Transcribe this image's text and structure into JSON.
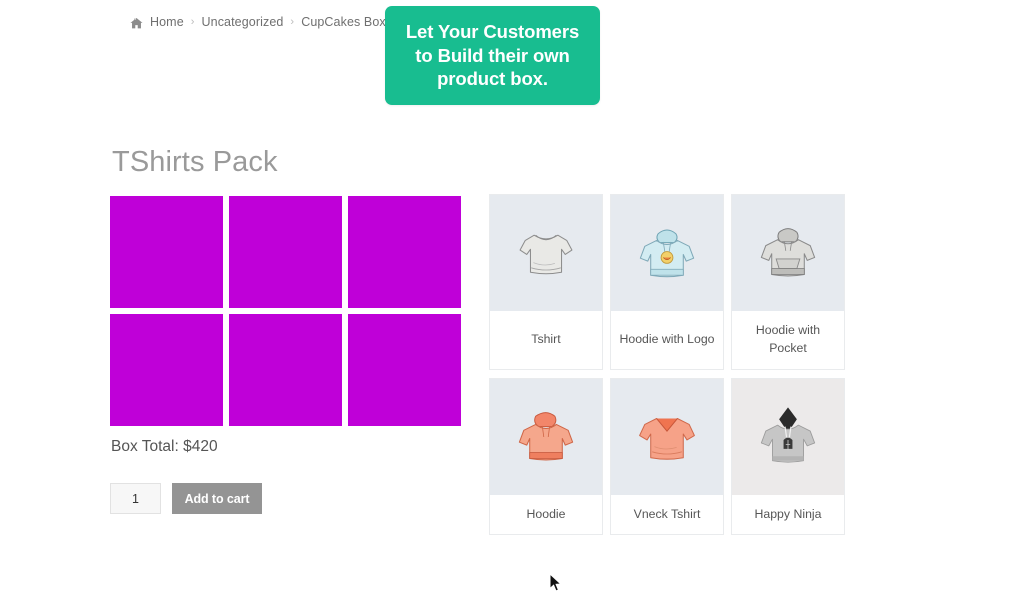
{
  "breadcrumb": {
    "home_icon": "home-icon",
    "items": [
      {
        "label": "Home",
        "current": false
      },
      {
        "label": "Uncategorized",
        "current": false
      },
      {
        "label": "CupCakes Box",
        "current": true
      }
    ],
    "separator": "›"
  },
  "promo": {
    "line1": "Let Your Customers",
    "line2": "to Build their own",
    "line3": "product box.",
    "bg_color": "#18bd90",
    "text_color": "#ffffff"
  },
  "product": {
    "title": "TShirts Pack",
    "box_total_label": "Box Total: $420",
    "quantity_value": "1",
    "quantity_placeholder": "1",
    "add_to_cart_label": "Add to cart",
    "add_to_cart_color": "#949494"
  },
  "box_slots": {
    "slot_color": "#bf00d8",
    "count": 6,
    "items": [
      {
        "index": 1,
        "filled": true
      },
      {
        "index": 2,
        "filled": true
      },
      {
        "index": 3,
        "filled": true
      },
      {
        "index": 4,
        "filled": true
      },
      {
        "index": 5,
        "filled": true
      },
      {
        "index": 6,
        "filled": true
      }
    ]
  },
  "products_grid": {
    "thumb_bg": "#e6eaef",
    "items": [
      {
        "name": "Tshirt",
        "icon": "tshirt-gray-icon"
      },
      {
        "name": "Hoodie with Logo",
        "icon": "hoodie-blue-logo-icon"
      },
      {
        "name": "Hoodie with Pocket",
        "icon": "hoodie-gray-pocket-icon"
      },
      {
        "name": "Hoodie",
        "icon": "hoodie-orange-icon"
      },
      {
        "name": "Vneck Tshirt",
        "icon": "vneck-tshirt-orange-icon"
      },
      {
        "name": "Happy Ninja",
        "icon": "happy-ninja-hoodie-icon"
      }
    ]
  }
}
